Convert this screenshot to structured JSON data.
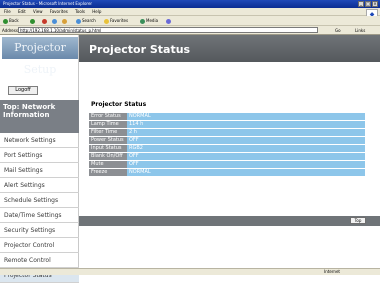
{
  "browser": {
    "window_title": "Projector Status - Microsoft Internet Explorer",
    "menu": [
      "File",
      "Edit",
      "View",
      "Favorites",
      "Tools",
      "Help"
    ],
    "toolbar": {
      "back": "Back",
      "search": "Search",
      "favorites": "Favorites",
      "media": "Media"
    },
    "address_label": "Address",
    "address_value": "http://192.168.1.10/admin/status_p.html",
    "go_label": "Go",
    "links_label": "Links"
  },
  "sidebar": {
    "logo_text": "Projector Setup",
    "logoff_label": "Logoff",
    "active_group": "Top: Network Information",
    "items": [
      {
        "label": "Network Settings"
      },
      {
        "label": "Port Settings"
      },
      {
        "label": "Mail Settings"
      },
      {
        "label": "Alert Settings"
      },
      {
        "label": "Schedule Settings"
      },
      {
        "label": "Date/Time Settings"
      },
      {
        "label": "Security Settings"
      },
      {
        "label": "Projector Control"
      },
      {
        "label": "Remote Control"
      },
      {
        "label": "Projector Status"
      }
    ]
  },
  "main": {
    "title": "Projector Status",
    "section_title": "Projector Status",
    "rows": [
      {
        "label": "Error Status",
        "value": "NORMAL"
      },
      {
        "label": "Lamp Time",
        "value": "114 h"
      },
      {
        "label": "Filter Time",
        "value": "2 h"
      },
      {
        "label": "Power Status",
        "value": "OFF"
      },
      {
        "label": "Input Status",
        "value": "RGB2"
      },
      {
        "label": "Blank On/Off",
        "value": "OFF"
      },
      {
        "label": "Mute",
        "value": "OFF"
      },
      {
        "label": "Freeze",
        "value": "NORMAL"
      }
    ],
    "top_button": "Top"
  },
  "statusbar": {
    "zone": "Internet"
  }
}
